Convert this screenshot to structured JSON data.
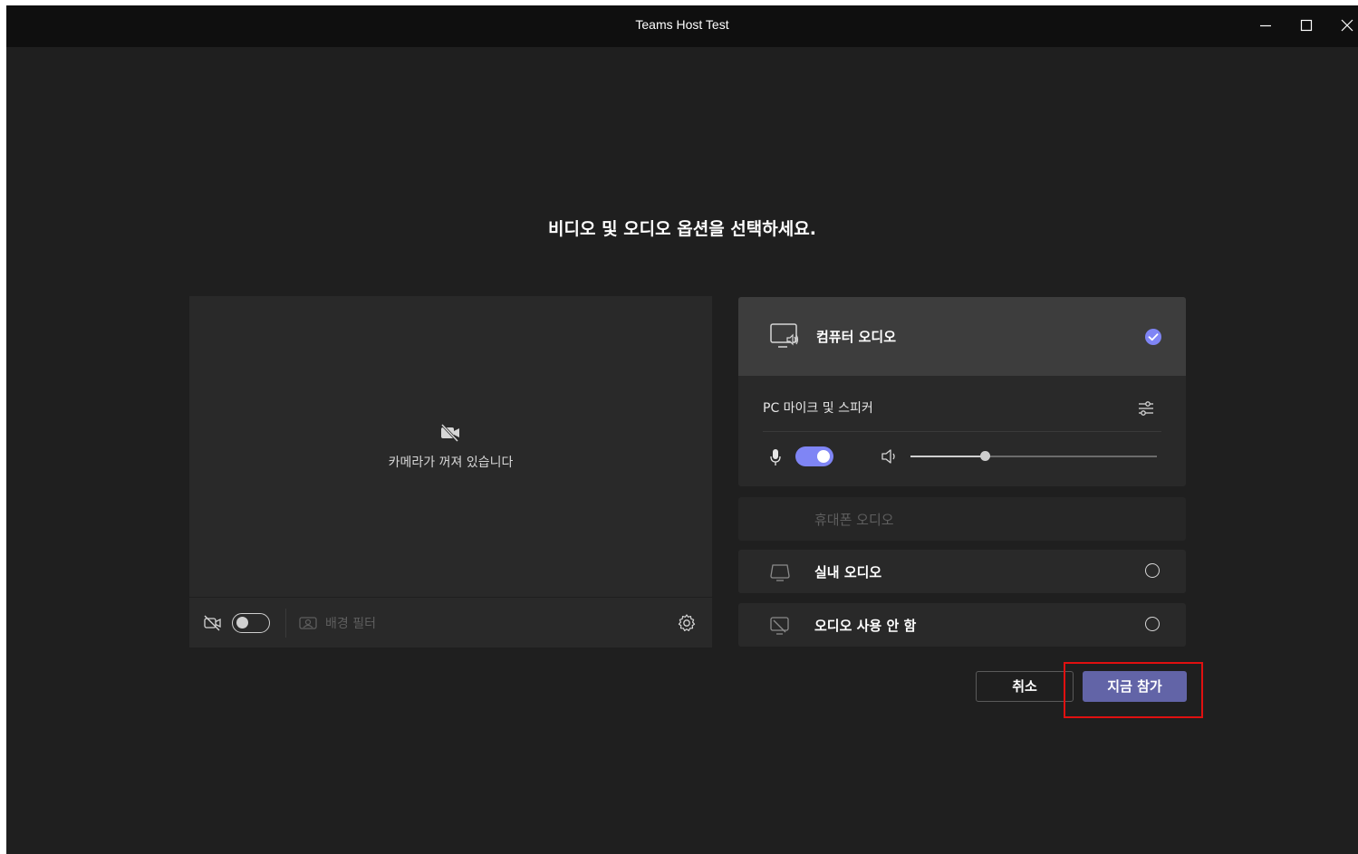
{
  "window": {
    "title": "Teams Host Test"
  },
  "heading": "비디오 및 오디오 옵션을 선택하세요.",
  "video": {
    "camera_off_text": "카메라가 꺼져 있습니다",
    "camera_toggle": false,
    "background_filter_label": "배경 필터"
  },
  "audio_options": {
    "computer": {
      "label": "컴퓨터 오디오",
      "selected": true,
      "device_label": "PC 마이크 및 스피커",
      "mic_on": true,
      "speaker_volume": 0.3
    },
    "phone": {
      "label": "휴대폰 오디오",
      "enabled": false
    },
    "room": {
      "label": "실내 오디오",
      "selected": false
    },
    "none": {
      "label": "오디오 사용 안 함",
      "selected": false
    }
  },
  "buttons": {
    "cancel": "취소",
    "join": "지금 참가"
  },
  "colors": {
    "accent": "#6264a7",
    "toggle_on": "#7f85f5",
    "highlight": "#e01010"
  },
  "icons": [
    "minimize-icon",
    "maximize-icon",
    "close-icon",
    "camera-off-icon",
    "background-filter-icon",
    "gear-icon",
    "computer-audio-icon",
    "check-circle-icon",
    "device-settings-icon",
    "mic-icon",
    "speaker-icon",
    "room-audio-icon",
    "no-audio-icon"
  ]
}
